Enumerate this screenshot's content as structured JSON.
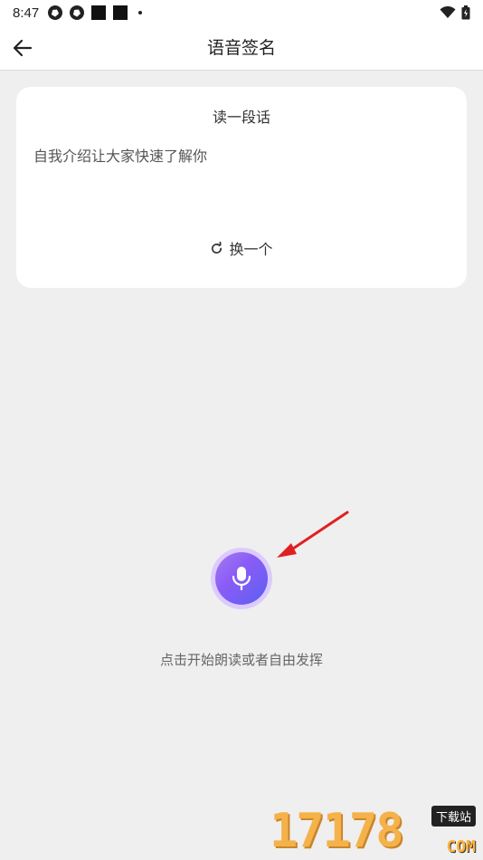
{
  "status_bar": {
    "time": "8:47",
    "icons": [
      "aperture-icon",
      "aperture-icon",
      "square-icon",
      "square-icon",
      "dot-icon"
    ],
    "right_icons": [
      "wifi-icon",
      "battery-icon"
    ]
  },
  "header": {
    "title": "语音签名",
    "back_icon": "arrow-left-icon"
  },
  "card": {
    "title": "读一段话",
    "prompt_text": "自我介绍让大家快速了解你",
    "change_label": "换一个",
    "change_icon": "refresh-icon"
  },
  "mic": {
    "icon": "microphone-icon",
    "hint": "点击开始朗读或者自由发挥"
  },
  "watermark": {
    "number": "17178",
    "badge": "下载站",
    "domain": "COM"
  },
  "colors": {
    "background": "#efefef",
    "card": "#ffffff",
    "mic_gradient_start": "#a67bf0",
    "mic_gradient_end": "#5b5ff2",
    "mic_ring": "#dccbff",
    "annotation_arrow": "#e02020"
  }
}
